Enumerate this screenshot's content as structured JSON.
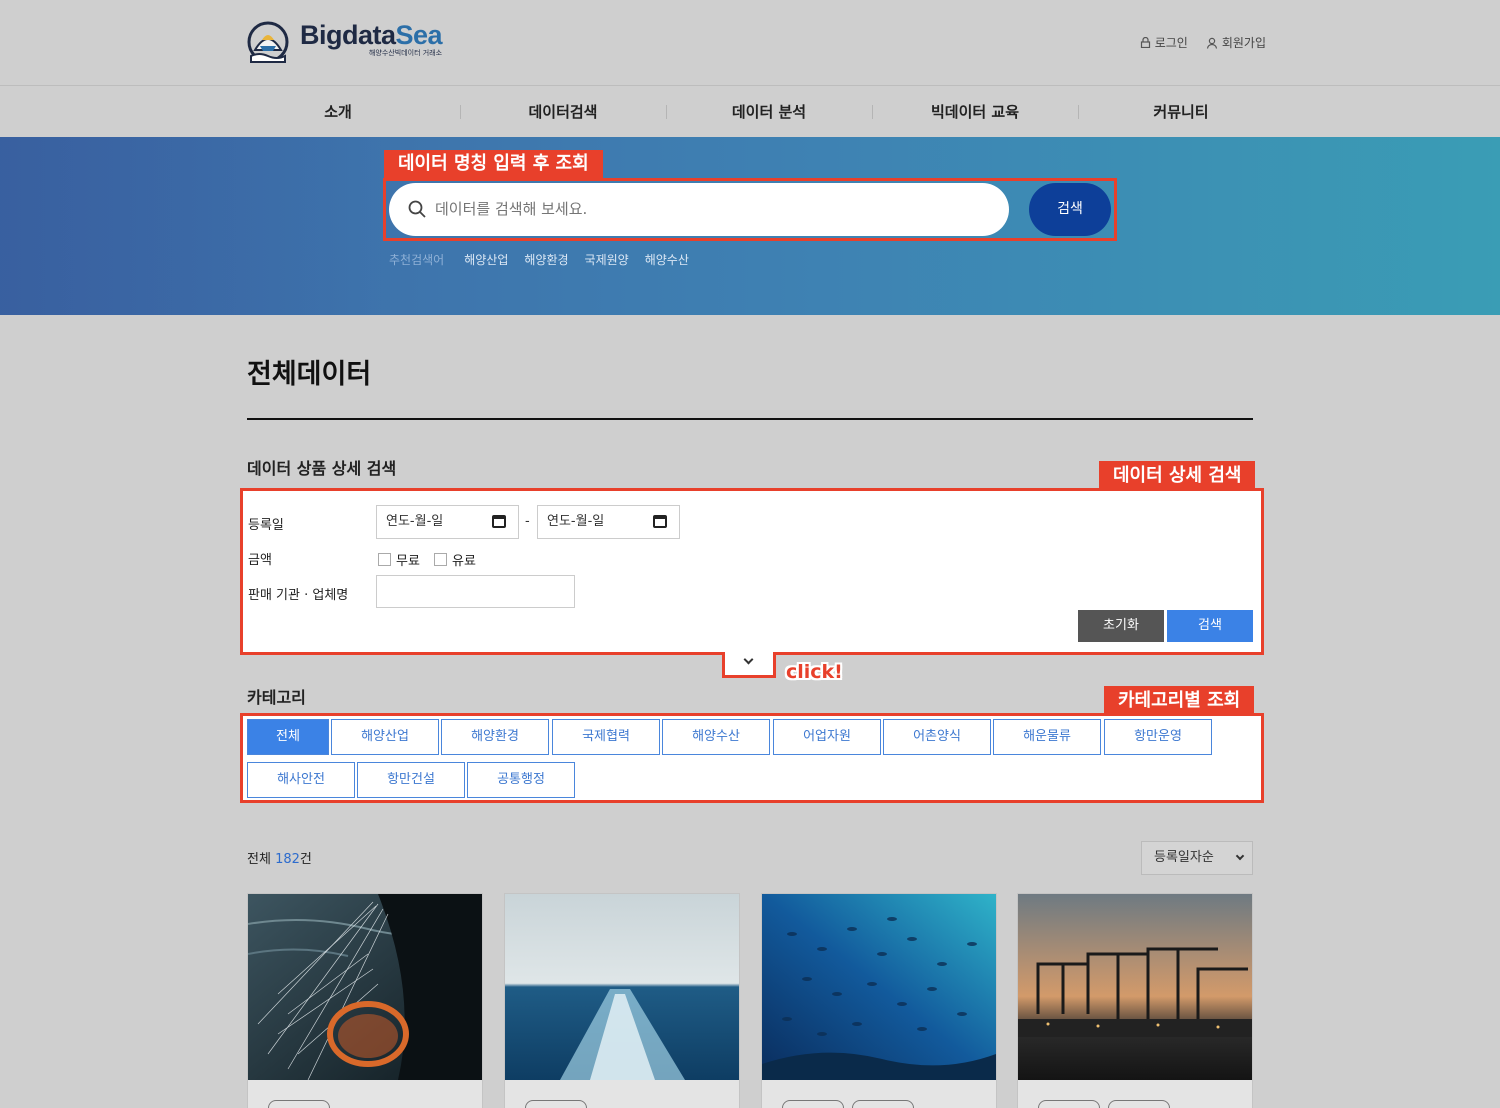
{
  "brand": {
    "name_a": "Bigdata",
    "name_b": "Sea",
    "subtitle": "해양수산빅데이터 거래소"
  },
  "util": {
    "login": "로그인",
    "signup": "회원가입"
  },
  "nav": {
    "items": [
      "소개",
      "데이터검색",
      "데이터 분석",
      "빅데이터 교육",
      "커뮤니티"
    ]
  },
  "hero": {
    "annotation": "데이터 명칭 입력 후 조회",
    "search_placeholder": "데이터를 검색해 보세요.",
    "search_button": "검색",
    "recommend_label": "추천검색어",
    "keywords": [
      "해양산업",
      "해양환경",
      "국제원양",
      "해양수산"
    ]
  },
  "main": {
    "page_title": "전체데이터",
    "detail": {
      "title": "데이터 상품 상세 검색",
      "annotation": "데이터 상세 검색",
      "reg_date_label": "등록일",
      "date_placeholder": "연도-월-일",
      "dash": "-",
      "price_label": "금액",
      "free": "무료",
      "paid": "유료",
      "org_label": "판매 기관 · 업체명",
      "reset": "초기화",
      "search": "검색"
    },
    "toggle_annotation": "click!",
    "category": {
      "title": "카테고리",
      "annotation": "카테고리별 조회",
      "items": [
        "전체",
        "해양산업",
        "해양환경",
        "국제협력",
        "해양수산",
        "어업자원",
        "어촌양식",
        "해운물류",
        "항만운영",
        "해사안전",
        "항만건설",
        "공통행정"
      ]
    },
    "result": {
      "label": "전체",
      "count": "182",
      "suffix": "건",
      "sort": "등록일자순"
    }
  },
  "colors": {
    "accent": "#3b82e6",
    "annotation_red": "#e8402b",
    "search_button": "#0d3f99"
  }
}
